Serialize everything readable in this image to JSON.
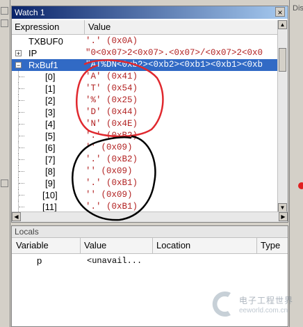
{
  "watch": {
    "title": "Watch 1",
    "columns": {
      "expression": "Expression",
      "value": "Value"
    },
    "rows": [
      {
        "expr": "TXBUF0",
        "value": "'.' (0x0A)",
        "kind": "plain"
      },
      {
        "expr": "IP",
        "value": "\"0<0x07>2<0x07>.<0x07>/<0x07>2<0x0",
        "kind": "collapsed"
      },
      {
        "expr": "RxBuf1",
        "value": "\"AT%DN<0xb2><0xb2><0xb1><0xb1><0xb",
        "kind": "expanded"
      },
      {
        "expr": "[0]",
        "value": "'A' (0x41)",
        "kind": "child"
      },
      {
        "expr": "[1]",
        "value": "'T' (0x54)",
        "kind": "child"
      },
      {
        "expr": "[2]",
        "value": "'%' (0x25)",
        "kind": "child"
      },
      {
        "expr": "[3]",
        "value": "'D' (0x44)",
        "kind": "child"
      },
      {
        "expr": "[4]",
        "value": "'N' (0x4E)",
        "kind": "child"
      },
      {
        "expr": "[5]",
        "value": "'.' (0xB2)",
        "kind": "child"
      },
      {
        "expr": "[6]",
        "value": "'' (0x09)",
        "kind": "child"
      },
      {
        "expr": "[7]",
        "value": "'.' (0xB2)",
        "kind": "child"
      },
      {
        "expr": "[8]",
        "value": "'' (0x09)",
        "kind": "child"
      },
      {
        "expr": "[9]",
        "value": "'.' (0xB1)",
        "kind": "child"
      },
      {
        "expr": "[10]",
        "value": "'' (0x09)",
        "kind": "child"
      },
      {
        "expr": "[11]",
        "value": "'.' (0xB1)",
        "kind": "child"
      }
    ],
    "close_label": "×"
  },
  "locals": {
    "title": "Locals",
    "columns": {
      "variable": "Variable",
      "value": "Value",
      "location": "Location",
      "type": "Type"
    },
    "rows": [
      {
        "variable": "p",
        "value": "<unavail..."
      }
    ]
  },
  "right_panel": {
    "title_fragment": "Dis"
  },
  "watermark": {
    "text_cn": "电子工程世界",
    "url": "eeworld.com.cn"
  },
  "colors": {
    "selection": "#316ac5",
    "value_text": "#b22222",
    "annotation_red": "#e0282e",
    "annotation_black": "#000000"
  }
}
